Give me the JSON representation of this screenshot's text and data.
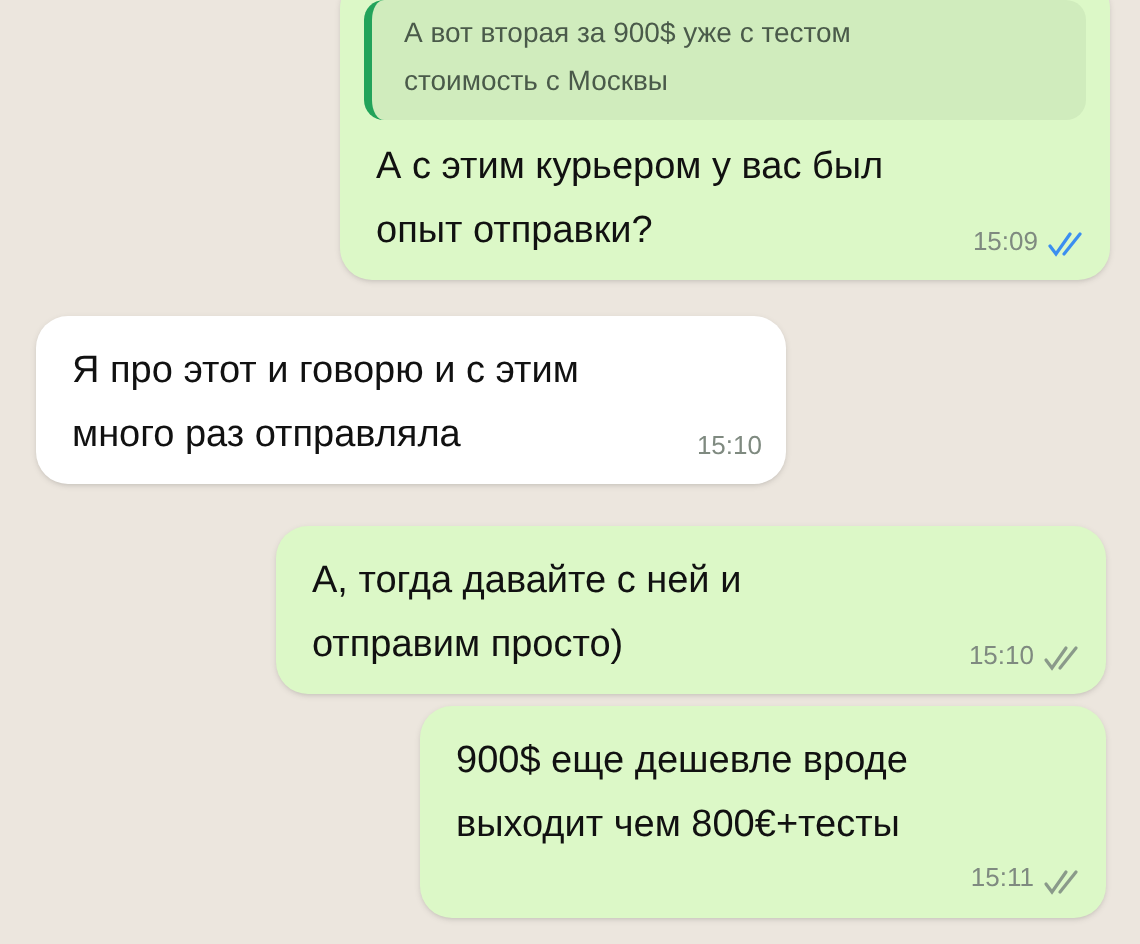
{
  "messages": [
    {
      "kind": "outgoing",
      "quote": "А вот вторая за 900$ уже с тестом стоимость с Москвы",
      "text": "А с этим курьером у вас был опыт отправки?",
      "time": "15:09",
      "read": true
    },
    {
      "kind": "incoming",
      "text": "Я про этот и говорю и с этим много раз отправляла",
      "time": "15:10"
    },
    {
      "kind": "outgoing",
      "text": "А, тогда давайте с ней и отправим просто)",
      "time": "15:10",
      "read": false
    },
    {
      "kind": "outgoing",
      "text": "900$ еще дешевле вроде выходит чем 800€+тесты",
      "time": "15:11",
      "read": false
    }
  ]
}
